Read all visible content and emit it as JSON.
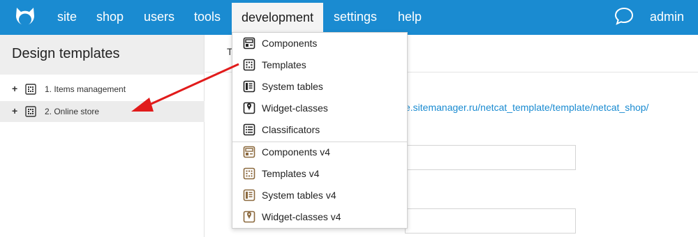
{
  "nav": {
    "items": [
      {
        "label": "site"
      },
      {
        "label": "shop"
      },
      {
        "label": "users"
      },
      {
        "label": "tools"
      },
      {
        "label": "development"
      },
      {
        "label": "settings"
      },
      {
        "label": "help"
      }
    ],
    "active": "development",
    "user": "admin"
  },
  "sidebar": {
    "title": "Design templates",
    "tree": [
      {
        "label": "1. Items management"
      },
      {
        "label": "2. Online store"
      }
    ]
  },
  "main": {
    "tab_letter": "T",
    "link_text": "e.sitemanager.ru/netcat_template/template/netcat_shop/"
  },
  "dropdown": {
    "items": [
      {
        "label": "Components",
        "icon": "component-icon",
        "legacy": false
      },
      {
        "label": "Templates",
        "icon": "template-icon",
        "legacy": false
      },
      {
        "label": "System tables",
        "icon": "system-table-icon",
        "legacy": false
      },
      {
        "label": "Widget-classes",
        "icon": "widget-class-icon",
        "legacy": false
      },
      {
        "label": "Classificators",
        "icon": "classificator-icon",
        "legacy": false
      },
      {
        "label": "Components v4",
        "icon": "component-icon",
        "legacy": true
      },
      {
        "label": "Templates v4",
        "icon": "template-icon",
        "legacy": true
      },
      {
        "label": "System tables v4",
        "icon": "system-table-icon",
        "legacy": true
      },
      {
        "label": "Widget-classes v4",
        "icon": "widget-class-icon",
        "legacy": true
      }
    ]
  },
  "colors": {
    "topbar": "#1a8bd1",
    "icon_dark": "#222222",
    "icon_legacy": "#8c6a3f",
    "arrow": "#e11b1b"
  }
}
